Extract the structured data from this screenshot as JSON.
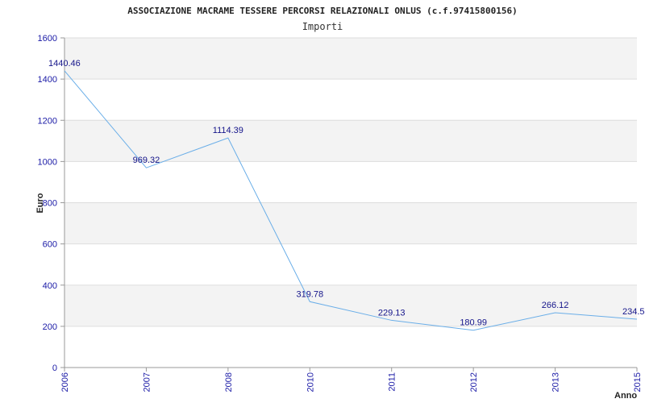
{
  "chart_data": {
    "type": "line",
    "title": "ASSOCIAZIONE MACRAME TESSERE PERCORSI RELAZIONALI ONLUS (c.f.97415800156)",
    "subtitle": "Importi",
    "xlabel": "Anno",
    "ylabel": "Euro",
    "categories": [
      "2006",
      "2007",
      "2008",
      "2010",
      "2011",
      "2012",
      "2013",
      "2015"
    ],
    "series": [
      {
        "values": [
          1440.46,
          969.32,
          1114.39,
          319.78,
          229.13,
          180.99,
          266.12,
          234.5
        ],
        "labels": [
          "1440.46",
          "969.32",
          "1114.39",
          "319.78",
          "229.13",
          "180.99",
          "266.12",
          "234.5"
        ]
      }
    ],
    "ylim": [
      0,
      1600
    ],
    "yticks": [
      "0",
      "200",
      "400",
      "600",
      "800",
      "1000",
      "1200",
      "1400",
      "1600"
    ],
    "grid": true,
    "band_color": "#f3f3f3",
    "line_color": "#6aaee8",
    "tick_color": "#1a1aa6"
  }
}
